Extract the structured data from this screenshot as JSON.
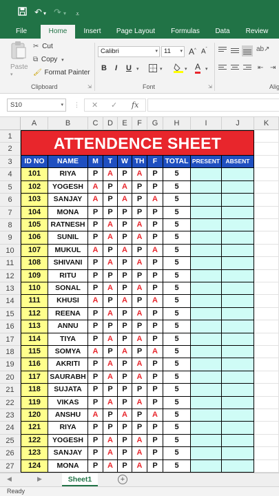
{
  "quick_access": {
    "save_icon": "save-icon",
    "undo_icon": "undo-icon",
    "redo_icon": "redo-icon",
    "customize_icon": "customize-qat-icon"
  },
  "ribbon_tabs": [
    "File",
    "Home",
    "Insert",
    "Page Layout",
    "Formulas",
    "Data",
    "Review"
  ],
  "active_tab": "Home",
  "clipboard": {
    "paste": "Paste",
    "cut": "Cut",
    "copy": "Copy",
    "format_painter": "Format Painter",
    "group_label": "Clipboard"
  },
  "font": {
    "name": "Calibri",
    "size": "11",
    "group_label": "Font",
    "bold": "B",
    "italic": "I",
    "underline": "U"
  },
  "alignment": {
    "group_label": "Alig"
  },
  "formula_bar": {
    "name_box": "S10",
    "cancel": "✕",
    "enter": "✓",
    "fx": "fx",
    "value": ""
  },
  "grid": {
    "columns": [
      "A",
      "B",
      "C",
      "D",
      "E",
      "F",
      "G",
      "H",
      "I",
      "J",
      "K"
    ],
    "row_numbers": [
      1,
      2,
      3,
      4,
      5,
      6,
      7,
      8,
      9,
      10,
      11,
      12,
      13,
      14,
      15,
      16,
      17,
      18,
      19,
      20,
      21,
      22,
      23,
      24,
      25,
      26,
      27
    ],
    "title": "ATTENDENCE SHEET",
    "headers": [
      "ID NO",
      "NAME",
      "M",
      "T",
      "W",
      "TH",
      "F",
      "TOTAL",
      "PRESENT",
      "ABSENT"
    ],
    "records": [
      {
        "id": "101",
        "name": "RIYA",
        "days": [
          "P",
          "A",
          "P",
          "A",
          "P"
        ],
        "total": "5"
      },
      {
        "id": "102",
        "name": "YOGESH",
        "days": [
          "A",
          "P",
          "A",
          "P",
          "P"
        ],
        "total": "5"
      },
      {
        "id": "103",
        "name": "SANJAY",
        "days": [
          "A",
          "P",
          "A",
          "P",
          "A"
        ],
        "total": "5"
      },
      {
        "id": "104",
        "name": "MONA",
        "days": [
          "P",
          "P",
          "P",
          "P",
          "P"
        ],
        "total": "5"
      },
      {
        "id": "105",
        "name": "RATNESH",
        "days": [
          "P",
          "A",
          "P",
          "A",
          "P"
        ],
        "total": "5"
      },
      {
        "id": "106",
        "name": "SUNIL",
        "days": [
          "P",
          "A",
          "P",
          "A",
          "P"
        ],
        "total": "5"
      },
      {
        "id": "107",
        "name": "MUKUL",
        "days": [
          "A",
          "P",
          "A",
          "P",
          "A"
        ],
        "total": "5"
      },
      {
        "id": "108",
        "name": "SHIVANI",
        "days": [
          "P",
          "A",
          "P",
          "A",
          "P"
        ],
        "total": "5"
      },
      {
        "id": "109",
        "name": "RITU",
        "days": [
          "P",
          "P",
          "P",
          "P",
          "P"
        ],
        "total": "5"
      },
      {
        "id": "110",
        "name": "SONAL",
        "days": [
          "P",
          "A",
          "P",
          "A",
          "P"
        ],
        "total": "5"
      },
      {
        "id": "111",
        "name": "KHUSI",
        "days": [
          "A",
          "P",
          "A",
          "P",
          "A"
        ],
        "total": "5"
      },
      {
        "id": "112",
        "name": "REENA",
        "days": [
          "P",
          "A",
          "P",
          "A",
          "P"
        ],
        "total": "5"
      },
      {
        "id": "113",
        "name": "ANNU",
        "days": [
          "P",
          "P",
          "P",
          "P",
          "P"
        ],
        "total": "5"
      },
      {
        "id": "114",
        "name": "TIYA",
        "days": [
          "P",
          "A",
          "P",
          "A",
          "P"
        ],
        "total": "5"
      },
      {
        "id": "115",
        "name": "SOMYA",
        "days": [
          "A",
          "P",
          "A",
          "P",
          "A"
        ],
        "total": "5"
      },
      {
        "id": "116",
        "name": "AKRITI",
        "days": [
          "P",
          "A",
          "P",
          "A",
          "P"
        ],
        "total": "5"
      },
      {
        "id": "117",
        "name": "SAURABH",
        "days": [
          "P",
          "A",
          "P",
          "A",
          "P"
        ],
        "total": "5"
      },
      {
        "id": "118",
        "name": "SUJATA",
        "days": [
          "P",
          "P",
          "P",
          "P",
          "P"
        ],
        "total": "5"
      },
      {
        "id": "119",
        "name": "VIKAS",
        "days": [
          "P",
          "A",
          "P",
          "A",
          "P"
        ],
        "total": "5"
      },
      {
        "id": "120",
        "name": "ANSHU",
        "days": [
          "A",
          "P",
          "A",
          "P",
          "A"
        ],
        "total": "5"
      },
      {
        "id": "121",
        "name": "RIYA",
        "days": [
          "P",
          "P",
          "P",
          "P",
          "P"
        ],
        "total": "5"
      },
      {
        "id": "122",
        "name": "YOGESH",
        "days": [
          "P",
          "A",
          "P",
          "A",
          "P"
        ],
        "total": "5"
      },
      {
        "id": "123",
        "name": "SANJAY",
        "days": [
          "P",
          "A",
          "P",
          "A",
          "P"
        ],
        "total": "5"
      },
      {
        "id": "124",
        "name": "MONA",
        "days": [
          "P",
          "A",
          "P",
          "A",
          "P"
        ],
        "total": "5"
      }
    ]
  },
  "sheet_tabs": [
    "Sheet1"
  ],
  "add_sheet": "+",
  "status": "Ready",
  "colors": {
    "excel_green": "#217346",
    "title_red": "#e8262c",
    "header_blue": "#1f4fc0",
    "id_yellow": "#ffff8c",
    "empty_cyan": "#cffcf6",
    "absent_red": "#e8262c"
  }
}
